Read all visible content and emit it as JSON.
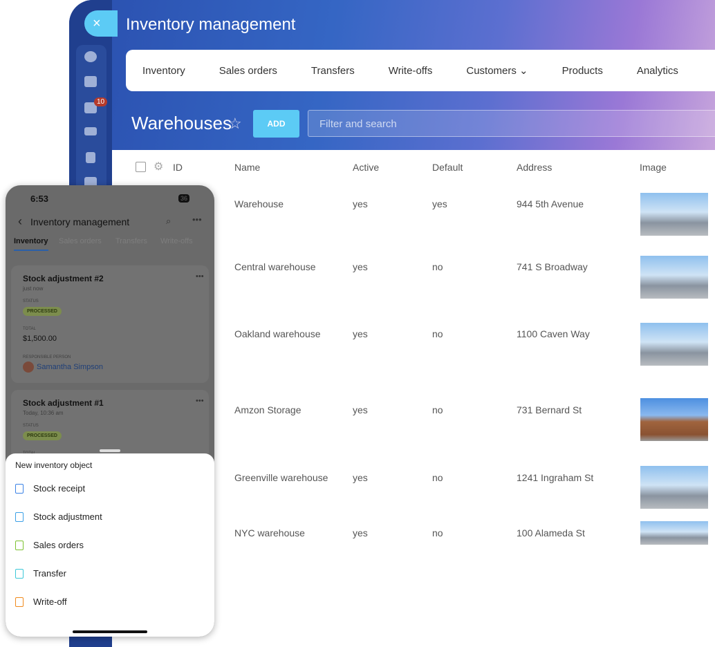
{
  "desktop": {
    "title": "Inventory management",
    "close_icon": "×",
    "badge": "10",
    "tabs": [
      "Inventory",
      "Sales orders",
      "Transfers",
      "Write-offs",
      "Customers ⌄",
      "Products",
      "Analytics"
    ],
    "page_title": "Warehouses",
    "add_label": "ADD",
    "search_placeholder": "Filter and search",
    "columns": [
      "ID",
      "Name",
      "Active",
      "Default",
      "Address",
      "Image"
    ],
    "rows": [
      {
        "name": "Warehouse",
        "active": "yes",
        "default": "yes",
        "address": "944 5th Avenue"
      },
      {
        "name": "Central warehouse",
        "active": "yes",
        "default": "no",
        "address": "741 S Broadway"
      },
      {
        "name": "Oakland warehouse",
        "active": "yes",
        "default": "no",
        "address": "1100 Caven Way"
      },
      {
        "name": "Amzon Storage",
        "active": "yes",
        "default": "no",
        "address": "731 Bernard St"
      },
      {
        "name": "Greenville warehouse",
        "active": "yes",
        "default": "no",
        "address": "1241 Ingraham St"
      },
      {
        "name": "NYC warehouse",
        "active": "yes",
        "default": "no",
        "address": "100 Alameda St"
      }
    ]
  },
  "phone": {
    "time": "6:53",
    "battery": "36",
    "title": "Inventory management",
    "tabs": [
      "Inventory",
      "Sales orders",
      "Transfers",
      "Write-offs"
    ],
    "cards": [
      {
        "title": "Stock adjustment #2",
        "time": "just now",
        "status_label": "STATUS",
        "status": "PROCESSED",
        "total_label": "TOTAL",
        "total": "$1,500.00",
        "person_label": "RESPONSIBLE PERSON",
        "person": "Samantha Simpson"
      },
      {
        "title": "Stock adjustment #1",
        "time": "Today, 10:36 am",
        "status_label": "STATUS",
        "status": "PROCESSED",
        "total_label": "TOTAL"
      }
    ],
    "sheet": {
      "title": "New inventory object",
      "items": [
        {
          "label": "Stock receipt",
          "color": "#3b82e6"
        },
        {
          "label": "Stock adjustment",
          "color": "#3ba0e6"
        },
        {
          "label": "Sales orders",
          "color": "#7cc12f"
        },
        {
          "label": "Transfer",
          "color": "#3cc8d8"
        },
        {
          "label": "Write-off",
          "color": "#f08a1c"
        }
      ]
    }
  }
}
